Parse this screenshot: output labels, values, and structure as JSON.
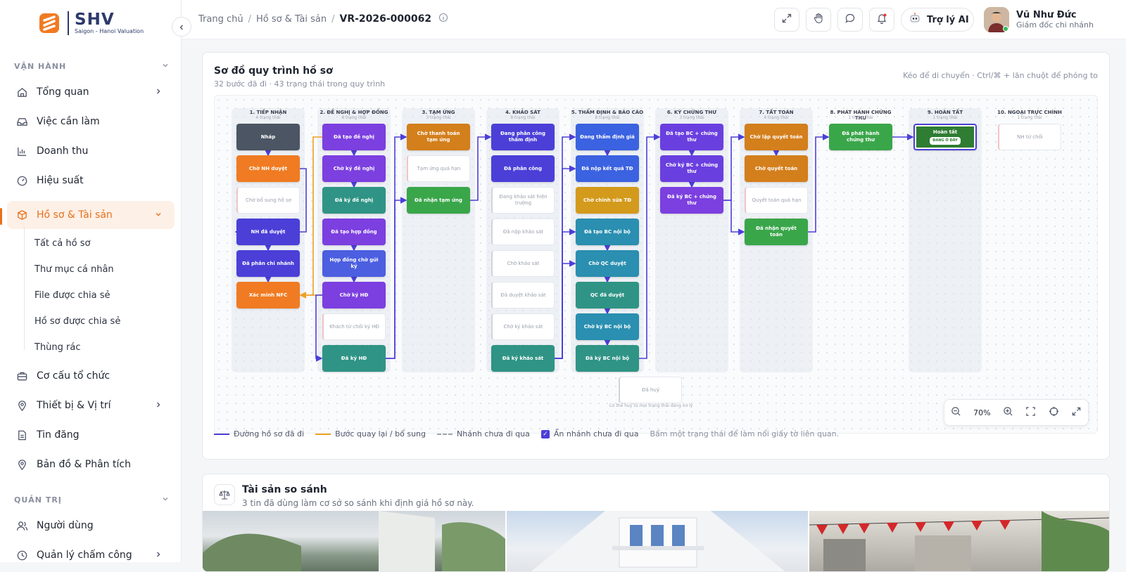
{
  "brand": {
    "name": "SHV",
    "tagline": "Saigon - Hanoi Valuation",
    "accent": "#e8701a"
  },
  "sidebar": {
    "section_ops": "VẬN HÀNH",
    "items": [
      {
        "label": "Tổng quan",
        "icon": "home-icon"
      },
      {
        "label": "Việc cần làm",
        "icon": "inbox-icon"
      },
      {
        "label": "Doanh thu",
        "icon": "bar-chart-icon"
      },
      {
        "label": "Hiệu suất",
        "icon": "gauge-icon"
      },
      {
        "label": "Hồ sơ & Tài sản",
        "icon": "box-icon"
      },
      {
        "label": "Cơ cấu tổ chức",
        "icon": "briefcase-icon"
      },
      {
        "label": "Thiết bị & Vị trí",
        "icon": "location-pin-icon"
      },
      {
        "label": "Tin đăng",
        "icon": "document-icon"
      },
      {
        "label": "Bản đồ & Phân tích",
        "icon": "map-pin-icon"
      }
    ],
    "subitems": [
      "Tất cả hồ sơ",
      "Thư mục cá nhân",
      "File được chia sẻ",
      "Hồ sơ được chia sẻ",
      "Thùng rác"
    ],
    "section_admin": "QUẢN TRỊ",
    "admin_items": [
      {
        "label": "Người dùng",
        "icon": "users-icon"
      },
      {
        "label": "Quản lý chấm công",
        "icon": "clock-icon"
      }
    ]
  },
  "topbar": {
    "breadcrumb": [
      "Trang chủ",
      "Hồ sơ & Tài sản",
      "VR-2026-000062"
    ],
    "ai_label": "Trợ lý AI",
    "user_name": "Vũ Như Đức",
    "user_role": "Giám đốc chi nhánh"
  },
  "workflow": {
    "title": "Sơ đồ quy trình hồ sơ",
    "subtitle": "32 bước đã đi · 43 trạng thái trong quy trình",
    "hint": "Kéo để di chuyển · Ctrl/⌘ + lăn chuột để phóng to",
    "columns": [
      {
        "title": "1. TIẾP NHẬN",
        "count": "4 trạng thái"
      },
      {
        "title": "2. ĐỀ NGHỊ & HỢP ĐỒNG",
        "count": "8 trạng thái"
      },
      {
        "title": "3. TẠM ỨNG",
        "count": "3 trạng thái"
      },
      {
        "title": "4. KHẢO SÁT",
        "count": "8 trạng thái"
      },
      {
        "title": "5. THẨM ĐỊNH & BÁO CÁO",
        "count": "8 trạng thái"
      },
      {
        "title": "6. KÝ CHỨNG THƯ",
        "count": "3 trạng thái"
      },
      {
        "title": "7. TẤT TOÁN",
        "count": "4 trạng thái"
      },
      {
        "title": "8. PHÁT HÀNH CHỨNG THƯ",
        "count": "1 trạng thái"
      },
      {
        "title": "9. HOÀN TẤT",
        "count": "1 trạng thái"
      },
      {
        "title": "10. NGOẠI TRỰC CHÍNH",
        "count": "1 trạng thái"
      }
    ],
    "nodes": [
      {
        "label": "Nháp",
        "color": "#4b5563"
      },
      {
        "label": "Chờ NH duyệt",
        "color": "#f07b22"
      },
      {
        "label": "Chờ bổ sung hồ sơ",
        "color": "ghost"
      },
      {
        "label": "NH đã duyệt",
        "color": "#4b3fd8"
      },
      {
        "label": "Đã phân chi nhánh",
        "color": "#4b3fd8"
      },
      {
        "label": "Xác minh NFC",
        "color": "#f07b22"
      },
      {
        "label": "Đã tạo đề nghị",
        "color": "#7c3fe0"
      },
      {
        "label": "Chờ ký đề nghị",
        "color": "#7c3fe0"
      },
      {
        "label": "Đã ký đề nghị",
        "color": "#2f9485"
      },
      {
        "label": "Đã tạo hợp đồng",
        "color": "#7c3fe0"
      },
      {
        "label": "Hợp đồng chờ gửi ký",
        "color": "#4b5fe0"
      },
      {
        "label": "Chờ ký HĐ",
        "color": "#7c3fe0"
      },
      {
        "label": "Khách từ chối ký HĐ",
        "color": "ghost"
      },
      {
        "label": "Đã ký HĐ",
        "color": "#2f9485"
      },
      {
        "label": "Chờ thanh toán tạm ứng",
        "color": "#d37f1c"
      },
      {
        "label": "Tạm ứng quá hạn",
        "color": "ghost"
      },
      {
        "label": "Đã nhận tạm ứng",
        "color": "#3aa64a"
      },
      {
        "label": "Đang phân công thẩm định",
        "color": "#4b3fd8"
      },
      {
        "label": "Đã phân công",
        "color": "#4b3fd8"
      },
      {
        "label": "Đang khảo sát hiện trường",
        "color": "ghost"
      },
      {
        "label": "Đã nộp khảo sát",
        "color": "ghost"
      },
      {
        "label": "Chờ khảo sát",
        "color": "ghost"
      },
      {
        "label": "Đã duyệt khảo sát",
        "color": "ghost"
      },
      {
        "label": "Chờ ký khảo sát",
        "color": "ghost"
      },
      {
        "label": "Đã ký khảo sát",
        "color": "#2f9485"
      },
      {
        "label": "Đang thẩm định giá",
        "color": "#3b62e0"
      },
      {
        "label": "Đã nộp kết quả TĐ",
        "color": "#3b62e0"
      },
      {
        "label": "Chờ chỉnh sửa TĐ",
        "color": "#d39a1c"
      },
      {
        "label": "Đã tạo BC nội bộ",
        "color": "#2a8fb0"
      },
      {
        "label": "Chờ QC duyệt",
        "color": "#2a8fb0"
      },
      {
        "label": "QC đã duyệt",
        "color": "#2f9485"
      },
      {
        "label": "Chờ ký BC nội bộ",
        "color": "#2a8fb0"
      },
      {
        "label": "Đã ký BC nội bộ",
        "color": "#2f9485"
      },
      {
        "label": "Đã tạo BC + chứng thư",
        "color": "#6a3fe0"
      },
      {
        "label": "Chờ ký BC + chứng thư",
        "color": "#6a3fe0"
      },
      {
        "label": "Đã ký BC + chứng thư",
        "color": "#7c3fe0"
      },
      {
        "label": "Chờ lập quyết toán",
        "color": "#d37f1c"
      },
      {
        "label": "Chờ quyết toán",
        "color": "#d37f1c"
      },
      {
        "label": "Quyết toán quá hạn",
        "color": "ghost"
      },
      {
        "label": "Đã nhận quyết toán",
        "color": "#3aa64a"
      },
      {
        "label": "Đã phát hành chứng thư",
        "color": "#3aa64a"
      },
      {
        "label": "Hoàn tất",
        "color": "#2e7d32",
        "badge": "ĐANG Ở ĐÂY"
      },
      {
        "label": "NH từ chối",
        "color": "ghost"
      },
      {
        "label": "Đã huỷ",
        "color": "ghost"
      }
    ],
    "cancel_note": "Có thể huỷ từ mọi trạng thái đang xử lý",
    "zoom": "70%",
    "legend": {
      "traveled": "Đường hồ sơ đã đi",
      "return": "Bước quay lại / bổ sung",
      "untraveled": "Nhánh chưa đi qua",
      "hide": "Ẩn nhánh chưa đi qua",
      "tip": "Bấm một trạng thái để làm nổi giấy tờ liên quan."
    }
  },
  "comparables": {
    "title": "Tài sản so sánh",
    "subtitle": "3 tin đã dùng làm cơ sở so sánh khi định giá hồ sơ này."
  }
}
